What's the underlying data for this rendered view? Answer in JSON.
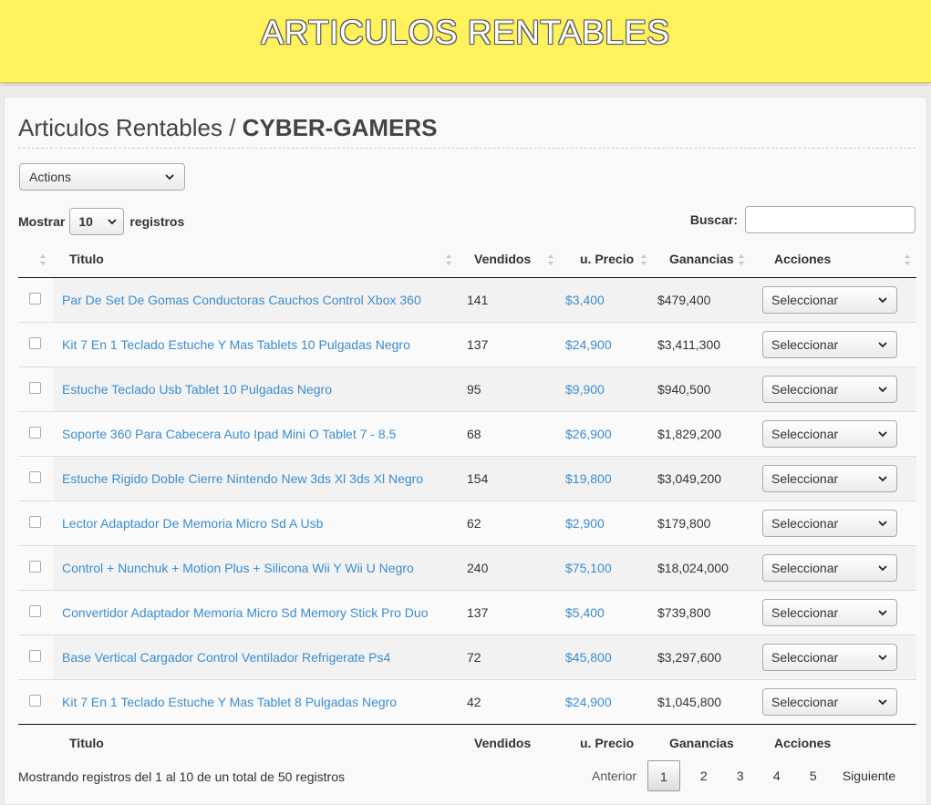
{
  "banner": {
    "title": "ARTICULOS RENTABLES"
  },
  "page": {
    "title_prefix": "Articulos Rentables / ",
    "title_store": "CYBER-GAMERS"
  },
  "bulk_actions": {
    "label": "Actions"
  },
  "length": {
    "prefix": "Mostrar",
    "value": "10",
    "suffix": "registros"
  },
  "search": {
    "label": "Buscar:",
    "value": ""
  },
  "table": {
    "columns": [
      "Titulo",
      "Vendidos",
      "u. Precio",
      "Ganancias",
      "Acciones"
    ],
    "rows": [
      {
        "titulo": "Par De Set De Gomas Conductoras Cauchos Control Xbox 360",
        "vendidos": "141",
        "precio": "$3,400",
        "ganancias": "$479,400",
        "accion": "Seleccionar"
      },
      {
        "titulo": "Kit 7 En 1 Teclado Estuche Y Mas Tablets 10 Pulgadas Negro",
        "vendidos": "137",
        "precio": "$24,900",
        "ganancias": "$3,411,300",
        "accion": "Seleccionar"
      },
      {
        "titulo": "Estuche Teclado Usb Tablet 10 Pulgadas Negro",
        "vendidos": "95",
        "precio": "$9,900",
        "ganancias": "$940,500",
        "accion": "Seleccionar"
      },
      {
        "titulo": "Soporte 360 Para Cabecera Auto Ipad Mini O Tablet 7 - 8.5",
        "vendidos": "68",
        "precio": "$26,900",
        "ganancias": "$1,829,200",
        "accion": "Seleccionar"
      },
      {
        "titulo": "Estuche Rigido Doble Cierre Nintendo New 3ds Xl 3ds Xl Negro",
        "vendidos": "154",
        "precio": "$19,800",
        "ganancias": "$3,049,200",
        "accion": "Seleccionar"
      },
      {
        "titulo": "Lector Adaptador De Memoria Micro Sd A Usb",
        "vendidos": "62",
        "precio": "$2,900",
        "ganancias": "$179,800",
        "accion": "Seleccionar"
      },
      {
        "titulo": "Control + Nunchuk + Motion Plus + Silicona Wii Y Wii U Negro",
        "vendidos": "240",
        "precio": "$75,100",
        "ganancias": "$18,024,000",
        "accion": "Seleccionar"
      },
      {
        "titulo": "Convertidor Adaptador Memoria Micro Sd Memory Stick Pro Duo",
        "vendidos": "137",
        "precio": "$5,400",
        "ganancias": "$739,800",
        "accion": "Seleccionar"
      },
      {
        "titulo": "Base Vertical Cargador Control Ventilador Refrigerate Ps4",
        "vendidos": "72",
        "precio": "$45,800",
        "ganancias": "$3,297,600",
        "accion": "Seleccionar"
      },
      {
        "titulo": "Kit 7 En 1 Teclado Estuche Y Mas Tablet 8 Pulgadas Negro",
        "vendidos": "42",
        "precio": "$24,900",
        "ganancias": "$1,045,800",
        "accion": "Seleccionar"
      }
    ]
  },
  "info": "Mostrando registros del 1 al 10 de un total de 50 registros",
  "pagination": {
    "prev": "Anterior",
    "pages": [
      "1",
      "2",
      "3",
      "4",
      "5"
    ],
    "current": "1",
    "next": "Siguiente"
  },
  "icons": {
    "chevron": "chevron-down-icon",
    "sort": "sort-icon"
  }
}
